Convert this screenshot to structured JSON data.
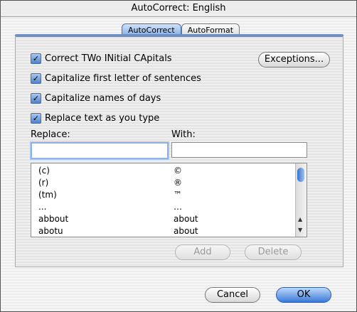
{
  "window": {
    "title": "AutoCorrect: English"
  },
  "tabs": [
    {
      "label": "AutoCorrect",
      "active": true
    },
    {
      "label": "AutoFormat",
      "active": false
    }
  ],
  "options": [
    {
      "label": "Correct TWo INitial CApitals",
      "checked": true
    },
    {
      "label": "Capitalize first letter of sentences",
      "checked": true
    },
    {
      "label": "Capitalize names of days",
      "checked": true
    },
    {
      "label": "Replace text as you type",
      "checked": true
    }
  ],
  "buttons": {
    "exceptions": "Exceptions...",
    "add": "Add",
    "delete": "Delete",
    "cancel": "Cancel",
    "ok": "OK"
  },
  "fields": {
    "replace_label": "Replace:",
    "with_label": "With:",
    "replace_value": "",
    "with_value": ""
  },
  "entries": [
    {
      "replace": "(c)",
      "with": "©"
    },
    {
      "replace": "(r)",
      "with": "®"
    },
    {
      "replace": "(tm)",
      "with": "™"
    },
    {
      "replace": "...",
      "with": "…"
    },
    {
      "replace": "abbout",
      "with": "about"
    },
    {
      "replace": "abotu",
      "with": "about"
    }
  ],
  "colors": {
    "accent": "#3b7ad9",
    "tab_active": "#7fa9e0"
  }
}
